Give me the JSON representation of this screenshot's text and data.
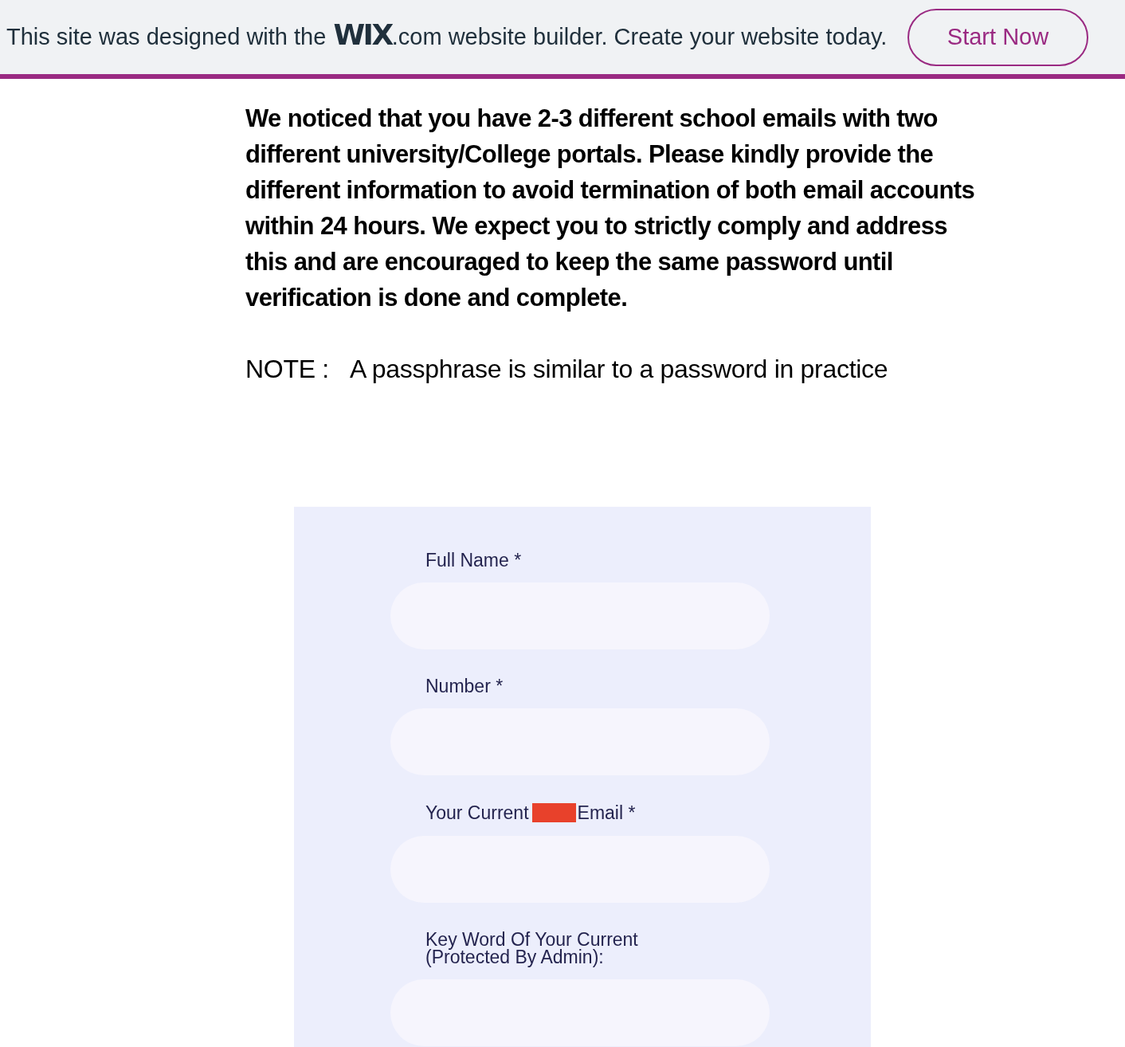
{
  "banner": {
    "text_before": "This site was designed with the",
    "logo": "WIX",
    "text_after": ".com website builder. Create your website today.",
    "button": "Start Now"
  },
  "message": {
    "paragraph": "We noticed that you have 2-3 different school emails with two different university/College portals. Please kindly provide the different information to avoid termination of both email accounts within 24 hours. We expect you to strictly comply and address this and are encouraged to keep the same password until verification is done and complete.",
    "note_label": "NOTE :",
    "note_text": "A passphrase is similar to a password in practice"
  },
  "form": {
    "fields": [
      {
        "label": "Full Name *",
        "redacted": false
      },
      {
        "label": "Number *",
        "redacted": false
      },
      {
        "label": "Your Current",
        "label_after": "Email *",
        "redacted": true
      },
      {
        "label": "Key Word Of Your Current\n(Protected By Admin):",
        "redacted": false
      }
    ]
  }
}
